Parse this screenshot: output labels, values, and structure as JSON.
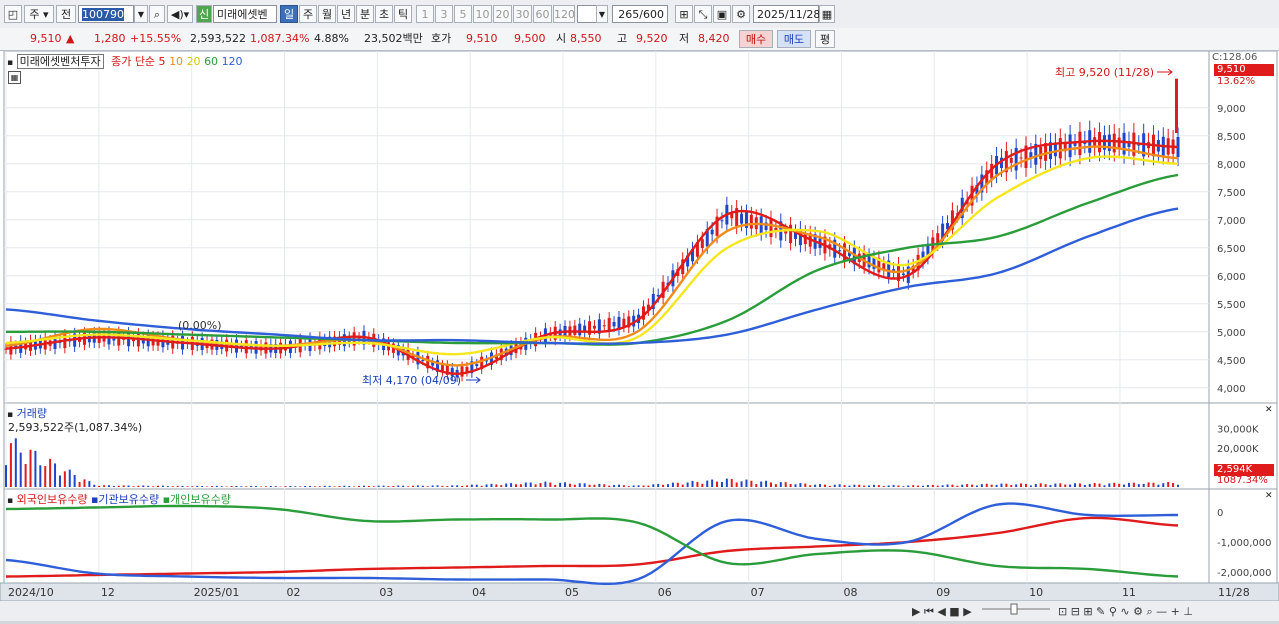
{
  "toolbar": {
    "mode": "주",
    "prev": "전",
    "code": "100790",
    "new_tag": "신",
    "name": "미래에셋벤",
    "periods": [
      "일",
      "주",
      "월",
      "년",
      "분",
      "초",
      "틱"
    ],
    "active_period": "일",
    "ticks": [
      "1",
      "3",
      "5",
      "10",
      "20",
      "30",
      "60",
      "120"
    ],
    "count": "265",
    "count_total": "/600",
    "date": "2025/11/28"
  },
  "quote": {
    "price": "9,510",
    "arrow": "▲",
    "change": "1,280",
    "change_pct": "+15.55%",
    "volume": "2,593,522",
    "volume_ratio": "1,087.34%",
    "turnover": "4.88%",
    "amount": "23,502백만",
    "bid_label": "호가",
    "bid1": "9,510",
    "bid2": "9,500",
    "open_label": "시",
    "open": "8,550",
    "high_label": "고",
    "high": "9,520",
    "low_label": "저",
    "low": "8,420",
    "buy": "매수",
    "sell": "매도",
    "eval": "평"
  },
  "price_panel": {
    "name": "미래에셋벤처투자",
    "ma_label": "종가 단순 5",
    "ma10": "10",
    "ma20": "20",
    "ma60": "60",
    "ma120": "120",
    "high_note": "최고 9,520 (11/28)",
    "low_note": "최저 4,170 (04/09)",
    "mid_note": "(0.00%)",
    "price_badge": "9,510",
    "pct_badge": "13.62%",
    "top_label": "C:128.06",
    "colors": {
      "up": "#e01b1b",
      "down": "#1f45c8",
      "ma5": "#e01b1b",
      "ma10": "#f08c1a",
      "ma20": "#f5e61e",
      "ma60": "#2a9d3a",
      "ma120": "#2e5fd8"
    }
  },
  "volume_panel": {
    "title": "거래량",
    "value": "2,593,522주(1,087.34%)",
    "badge": "2,594K",
    "badge2": "1087.34%"
  },
  "holdings_panel": {
    "series": [
      "외국인보유수량",
      "기관보유수량",
      "개인보유수량"
    ],
    "colors": [
      "#e01b1b",
      "#2e5fd8",
      "#2a9d3a"
    ]
  },
  "xaxis": [
    "2024/10",
    "12",
    "2025/01",
    "02",
    "03",
    "04",
    "05",
    "06",
    "07",
    "08",
    "09",
    "10",
    "11"
  ],
  "xaxis_right": "11/28",
  "chart_data": [
    {
      "type": "line",
      "title": "미래에셋벤처투자",
      "ylim": [
        3800,
        9800
      ],
      "yticks": [
        "9,000",
        "8,500",
        "8,000",
        "7,500",
        "7,000",
        "6,500",
        "6,000",
        "5,500",
        "5,000",
        "4,500",
        "4,000"
      ],
      "x": [
        "2024/10",
        "12",
        "2025/01",
        "02",
        "03",
        "04",
        "05",
        "06",
        "07",
        "08",
        "09",
        "10",
        "11",
        "11/28"
      ],
      "series": [
        {
          "name": "5",
          "values": [
            4700,
            4900,
            4800,
            4700,
            4900,
            4250,
            4950,
            5200,
            7100,
            6600,
            6000,
            8000,
            8400,
            8300
          ]
        },
        {
          "name": "10",
          "values": [
            4750,
            5050,
            4850,
            4750,
            4850,
            4400,
            4900,
            5000,
            6800,
            6700,
            6100,
            7800,
            8300,
            8100
          ]
        },
        {
          "name": "20",
          "values": [
            4800,
            4950,
            4850,
            4750,
            4800,
            4600,
            4900,
            4900,
            6500,
            6800,
            6200,
            7400,
            8100,
            8000
          ]
        },
        {
          "name": "60",
          "values": [
            5000,
            5000,
            4950,
            4900,
            4850,
            4800,
            4800,
            4800,
            5200,
            6100,
            6500,
            6700,
            7300,
            7800
          ]
        },
        {
          "name": "120",
          "values": [
            5400,
            5200,
            5050,
            4950,
            4850,
            4850,
            4800,
            4800,
            4950,
            5400,
            5800,
            6050,
            6700,
            7200
          ]
        }
      ]
    },
    {
      "type": "bar",
      "title": "거래량",
      "ylim": [
        0,
        40000
      ],
      "yticks": [
        "30,000K",
        "20,000K",
        "10,000K"
      ],
      "categories": [
        "2024/10",
        "12",
        "2025/01",
        "02",
        "03",
        "04",
        "05",
        "06",
        "07",
        "08",
        "09",
        "10",
        "11",
        "11/28"
      ],
      "values": [
        28000,
        1000,
        600,
        500,
        700,
        900,
        2800,
        800,
        4500,
        1500,
        900,
        1800,
        2000,
        2594
      ]
    },
    {
      "type": "line",
      "ylim": [
        -2300000,
        300000
      ],
      "yticks": [
        "0",
        "-1,000,000",
        "-2,000,000"
      ],
      "x": [
        "2024/10",
        "12",
        "2025/01",
        "02",
        "03",
        "04",
        "05",
        "06",
        "07",
        "08",
        "09",
        "10",
        "11",
        "11/28"
      ],
      "series": [
        {
          "name": "외국인보유수량",
          "values": [
            -2150000,
            -2100000,
            -2050000,
            -2000000,
            -1900000,
            -1850000,
            -1800000,
            -1750000,
            -1300000,
            -1150000,
            -1000000,
            -700000,
            -200000,
            -450000
          ]
        },
        {
          "name": "기관보유수량",
          "values": [
            -1600000,
            -2050000,
            -2150000,
            -2200000,
            -2200000,
            -2250000,
            -2250000,
            -2250000,
            -300000,
            -900000,
            -1000000,
            250000,
            -100000,
            -100000
          ]
        },
        {
          "name": "개인보유수량",
          "values": [
            100000,
            150000,
            200000,
            100000,
            -300000,
            -250000,
            -250000,
            -350000,
            -1700000,
            -1400000,
            -1300000,
            -1800000,
            -1900000,
            -2150000
          ]
        }
      ]
    }
  ]
}
